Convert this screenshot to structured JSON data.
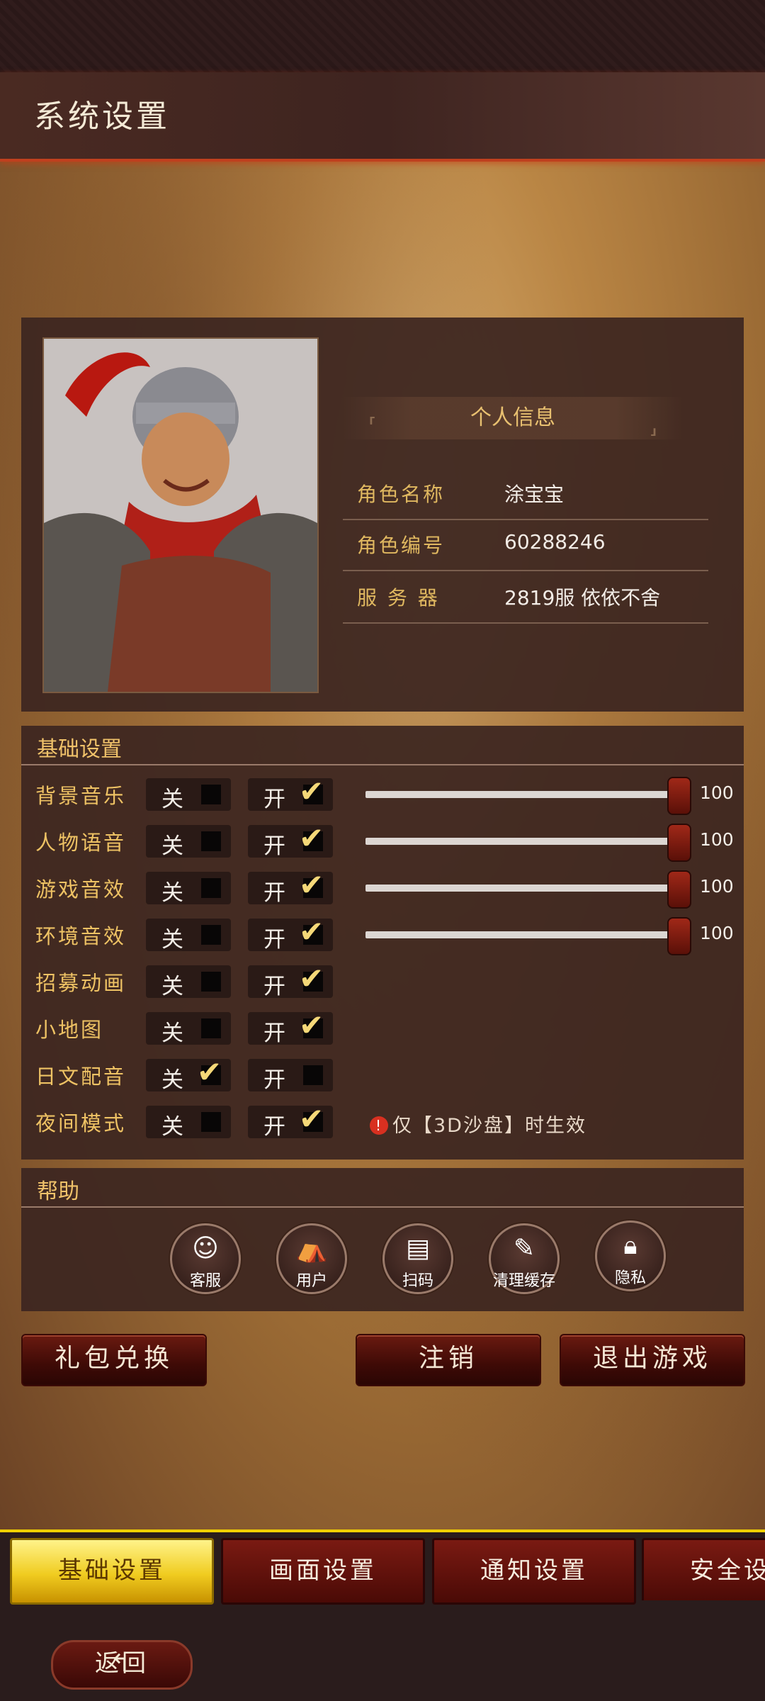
{
  "title": "系统设置",
  "profile": {
    "header": "个人信息",
    "rows": [
      {
        "label": "角色名称",
        "value": "涂宝宝"
      },
      {
        "label": "角色编号",
        "value": "60288246"
      },
      {
        "label": "服 务 器",
        "value": "2819服 依依不舍"
      }
    ]
  },
  "basic": {
    "header": "基础设置",
    "off_label": "关",
    "on_label": "开",
    "rows": [
      {
        "label": "背景音乐",
        "on": true,
        "volume": 100,
        "volume_text": "100"
      },
      {
        "label": "人物语音",
        "on": true,
        "volume": 100,
        "volume_text": "100"
      },
      {
        "label": "游戏音效",
        "on": true,
        "volume": 100,
        "volume_text": "100"
      },
      {
        "label": "环境音效",
        "on": true,
        "volume": 100,
        "volume_text": "100"
      },
      {
        "label": "招募动画",
        "on": true
      },
      {
        "label": "小地图",
        "on": true
      },
      {
        "label": "日文配音",
        "on": false
      },
      {
        "label": "夜间模式",
        "on": true
      }
    ],
    "note": "仅【3D沙盘】时生效",
    "note_icon": "!"
  },
  "help": {
    "header": "帮助",
    "items": [
      {
        "label": "客服",
        "icon": "customer-service-icon"
      },
      {
        "label": "用户",
        "icon": "user-tent-icon"
      },
      {
        "label": "扫码",
        "icon": "scan-icon"
      },
      {
        "label": "清理缓存",
        "icon": "broom-icon"
      },
      {
        "label": "隐私",
        "icon": "lock-icon"
      }
    ]
  },
  "actions": {
    "gift": "礼包兑换",
    "logout": "注销",
    "exit": "退出游戏"
  },
  "tabs": [
    {
      "label": "基础设置",
      "active": true
    },
    {
      "label": "画面设置",
      "active": false
    },
    {
      "label": "通知设置",
      "active": false
    },
    {
      "label": "安全设置",
      "active": false
    }
  ],
  "back_label": "返回",
  "back_icon": "↰",
  "colors": {
    "accent_yellow": "#f0cc20",
    "label_gold": "#eec264",
    "button_red": "#5a1008"
  }
}
